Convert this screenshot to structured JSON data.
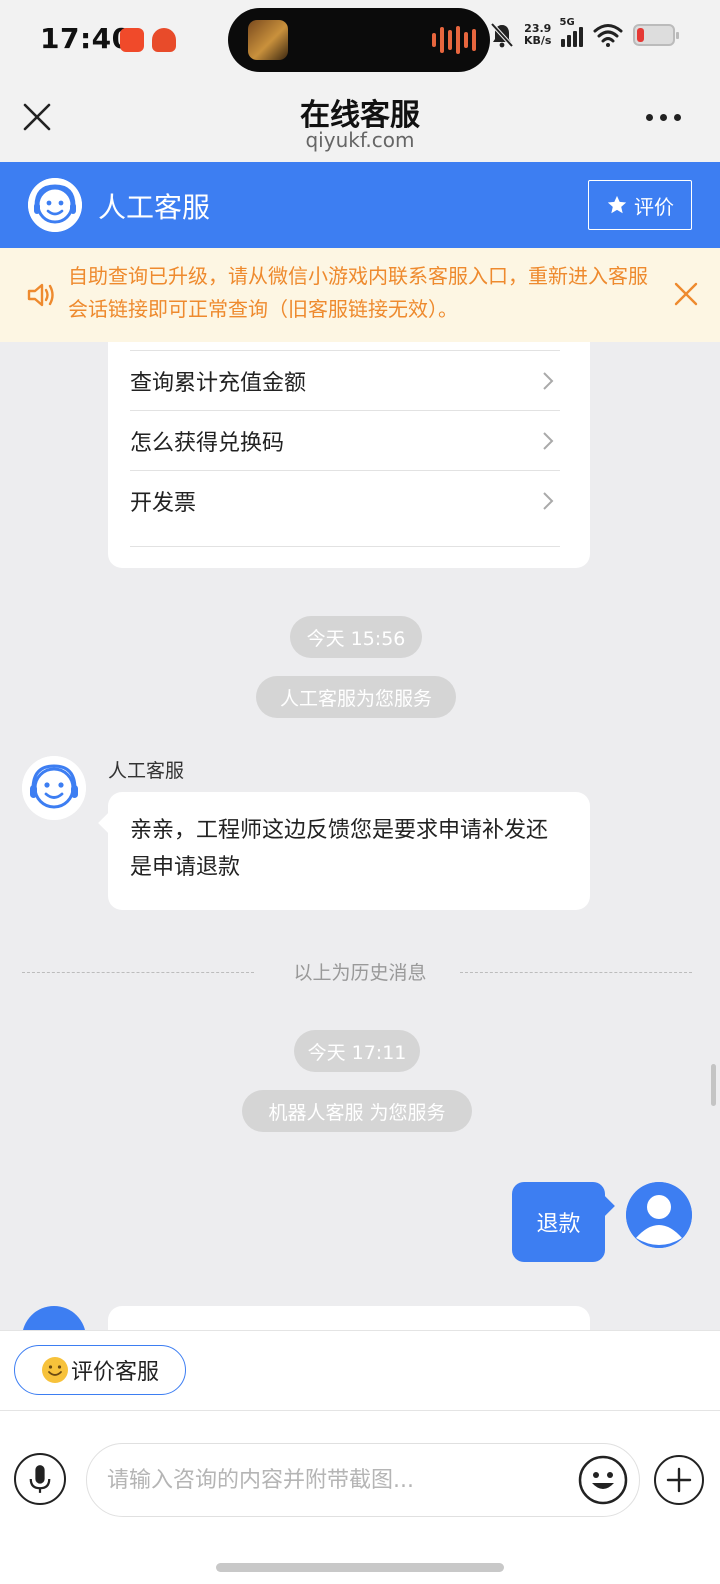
{
  "status_bar": {
    "time": "17:40",
    "net_speed_value": "23.9",
    "net_speed_unit": "KB/s",
    "network": "5G"
  },
  "title_bar": {
    "title": "在线客服",
    "subtitle": "qiyukf.com"
  },
  "agent_header": {
    "name": "人工客服",
    "rate_label": "评价"
  },
  "notice": {
    "text": "自助查询已升级，请从微信小游戏内联系客服入口，重新进入客服会话链接即可正常查询（旧客服链接无效）。"
  },
  "faq": {
    "items": [
      {
        "label": "查询累计充值金额"
      },
      {
        "label": "怎么获得兑换码"
      },
      {
        "label": "开发票"
      }
    ]
  },
  "messages": {
    "time_1": "今天 15:56",
    "system_1": "人工客服为您服务",
    "agent_name": "人工客服",
    "agent_message": "亲亲，工程师这边反馈您是要求申请补发还是申请退款",
    "history_divider": "以上为历史消息",
    "time_2": "今天 17:11",
    "system_2": "机器人客服 为您服务",
    "user_message": "退款"
  },
  "bottom": {
    "rate_agent_label": "评价客服",
    "input_placeholder": "请输入咨询的内容并附带截图..."
  },
  "colors": {
    "accent": "#3d7ef2",
    "notice_text": "#ee8a2e",
    "notice_bg": "#fdf6e3",
    "chat_bg": "#ededef"
  }
}
